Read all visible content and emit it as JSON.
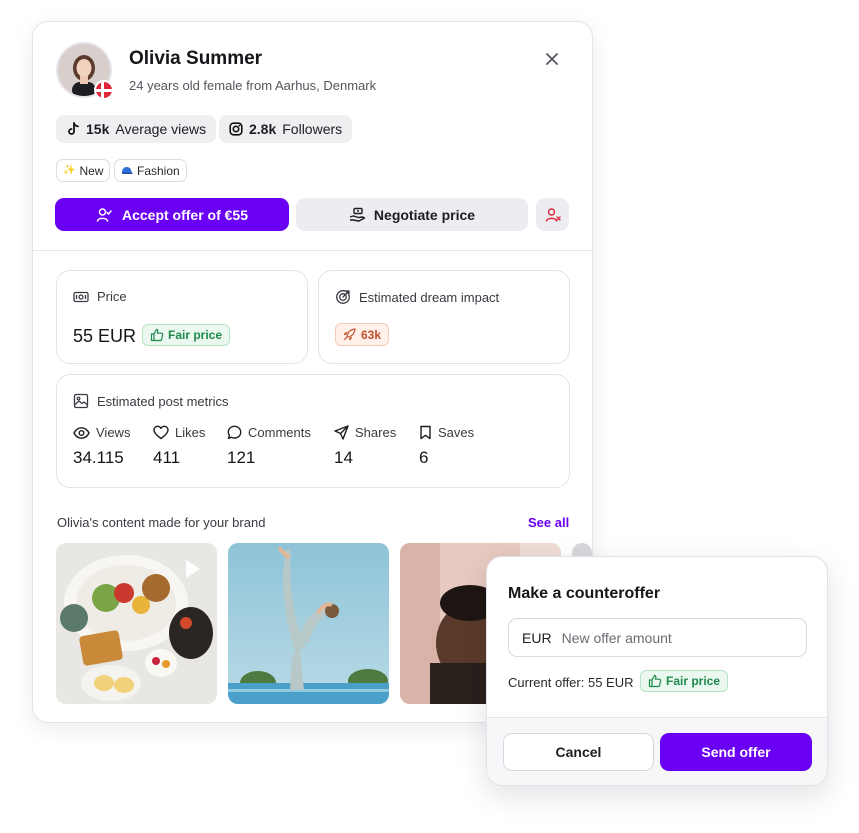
{
  "profile": {
    "name": "Olivia Summer",
    "subtitle": "24 years old female from Aarhus, Denmark"
  },
  "stats": [
    {
      "value": "15k",
      "label": "Average views",
      "icon": "tiktok-icon"
    },
    {
      "value": "2.8k",
      "label": "Followers",
      "icon": "instagram-icon"
    }
  ],
  "tags": [
    {
      "emoji": "✨",
      "label": "New"
    },
    {
      "emoji": "🧢",
      "label": "Fashion"
    }
  ],
  "actions": {
    "accept_label": "Accept offer of €55",
    "negotiate_label": "Negotiate price"
  },
  "price_panel": {
    "title": "Price",
    "value": "55 EUR",
    "badge": "Fair price"
  },
  "impact_panel": {
    "title": "Estimated dream impact",
    "badge": "63k"
  },
  "metrics_panel": {
    "title": "Estimated post metrics",
    "items": [
      {
        "label": "Views",
        "value": "34.115",
        "icon": "eye-icon"
      },
      {
        "label": "Likes",
        "value": "411",
        "icon": "heart-icon"
      },
      {
        "label": "Comments",
        "value": "121",
        "icon": "comment-icon"
      },
      {
        "label": "Shares",
        "value": "14",
        "icon": "send-icon"
      },
      {
        "label": "Saves",
        "value": "6",
        "icon": "bookmark-icon"
      }
    ]
  },
  "content": {
    "title": "Olivia's content made for your brand",
    "see_all": "See all"
  },
  "counteroffer": {
    "title": "Make a counteroffer",
    "currency": "EUR",
    "placeholder": "New offer amount",
    "current_offer": "Current offer: 55 EUR",
    "badge": "Fair price",
    "cancel_label": "Cancel",
    "send_label": "Send offer"
  },
  "colors": {
    "accent": "#6a00f4",
    "fair_green": "#1f8a4c",
    "impact_orange": "#c0512c"
  }
}
